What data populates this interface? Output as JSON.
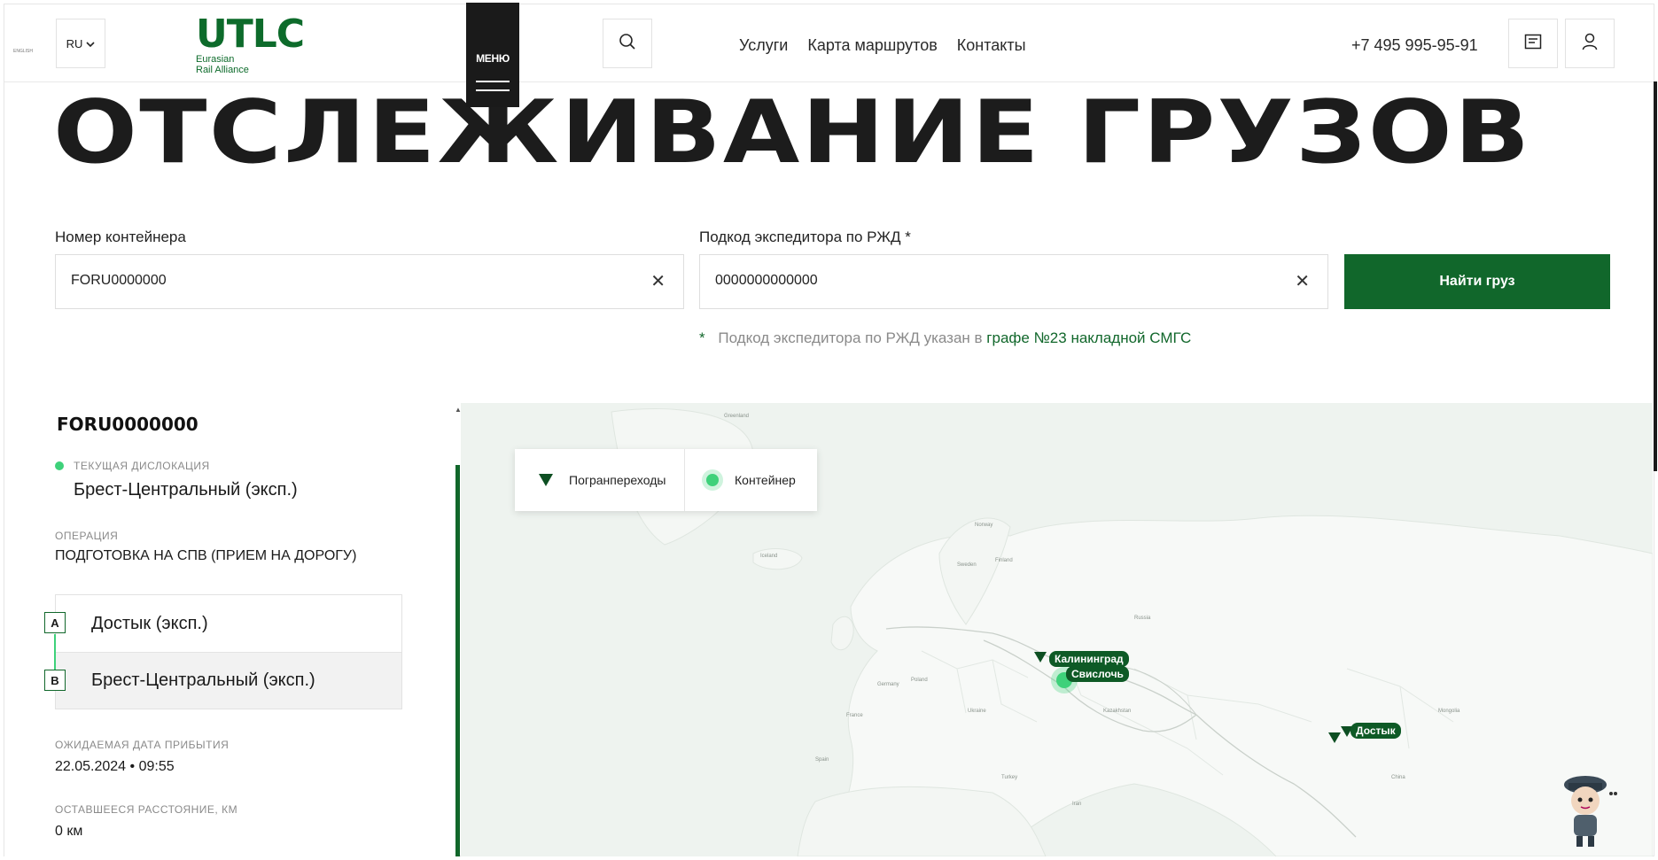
{
  "header": {
    "tiny_text": "ENGLISH",
    "lang": "RU",
    "logo": {
      "main": "UTLC",
      "sub1": "Eurasian",
      "sub2": "Rail Alliance"
    },
    "menu_label": "МЕНЮ",
    "nav": [
      "Услуги",
      "Карта маршрутов",
      "Контакты"
    ],
    "phone": "+7 495 995-95-91"
  },
  "page": {
    "title": "ОТСЛЕЖИВАНИЕ ГРУЗОВ"
  },
  "form": {
    "container_label": "Номер контейнера",
    "container_value": "FORU0000000",
    "code_label": "Подкод экспедитора по РЖД *",
    "code_value": "0000000000000",
    "clear_glyph": "✕",
    "submit": "Найти груз",
    "note_star": "*",
    "note_text": "Подкод экспедитора по РЖД указан в",
    "note_link": "графе №23 накладной СМГС"
  },
  "result": {
    "container_id": "FORU0000000",
    "current_location_label": "ТЕКУЩАЯ ДИСЛОКАЦИЯ",
    "current_location": "Брест-Центральный (эксп.)",
    "operation_label": "ОПЕРАЦИЯ",
    "operation": "ПОДГОТОВКА НА СПВ (ПРИЕМ НА ДОРОГУ)",
    "route": [
      {
        "pin": "A",
        "station": "Достык (эксп.)"
      },
      {
        "pin": "B",
        "station": "Брест-Центральный (эксп.)"
      }
    ],
    "eta_label": "ОЖИДАЕМАЯ ДАТА ПРИБЫТИЯ",
    "eta": "22.05.2024 • 09:55",
    "distance_label": "ОСТАВШЕЕСЯ РАССТОЯНИЕ, КМ",
    "distance": "0 км"
  },
  "map": {
    "legend": {
      "border_crossings": "Погранпереходы",
      "container": "Контейнер"
    },
    "tags": [
      "Калининград",
      "Свислочь",
      "Достык"
    ],
    "place_labels": [
      "Greenland",
      "Iceland",
      "Sweden",
      "Finland",
      "Norway",
      "Russia",
      "Mongolia",
      "Kazakhstan",
      "Poland",
      "Germany",
      "France",
      "Spain",
      "Turkey",
      "Iran",
      "China",
      "Ukraine"
    ],
    "colors": {
      "brand": "#11672b",
      "accent": "#3ed17a",
      "land": "#edf2ee"
    }
  }
}
